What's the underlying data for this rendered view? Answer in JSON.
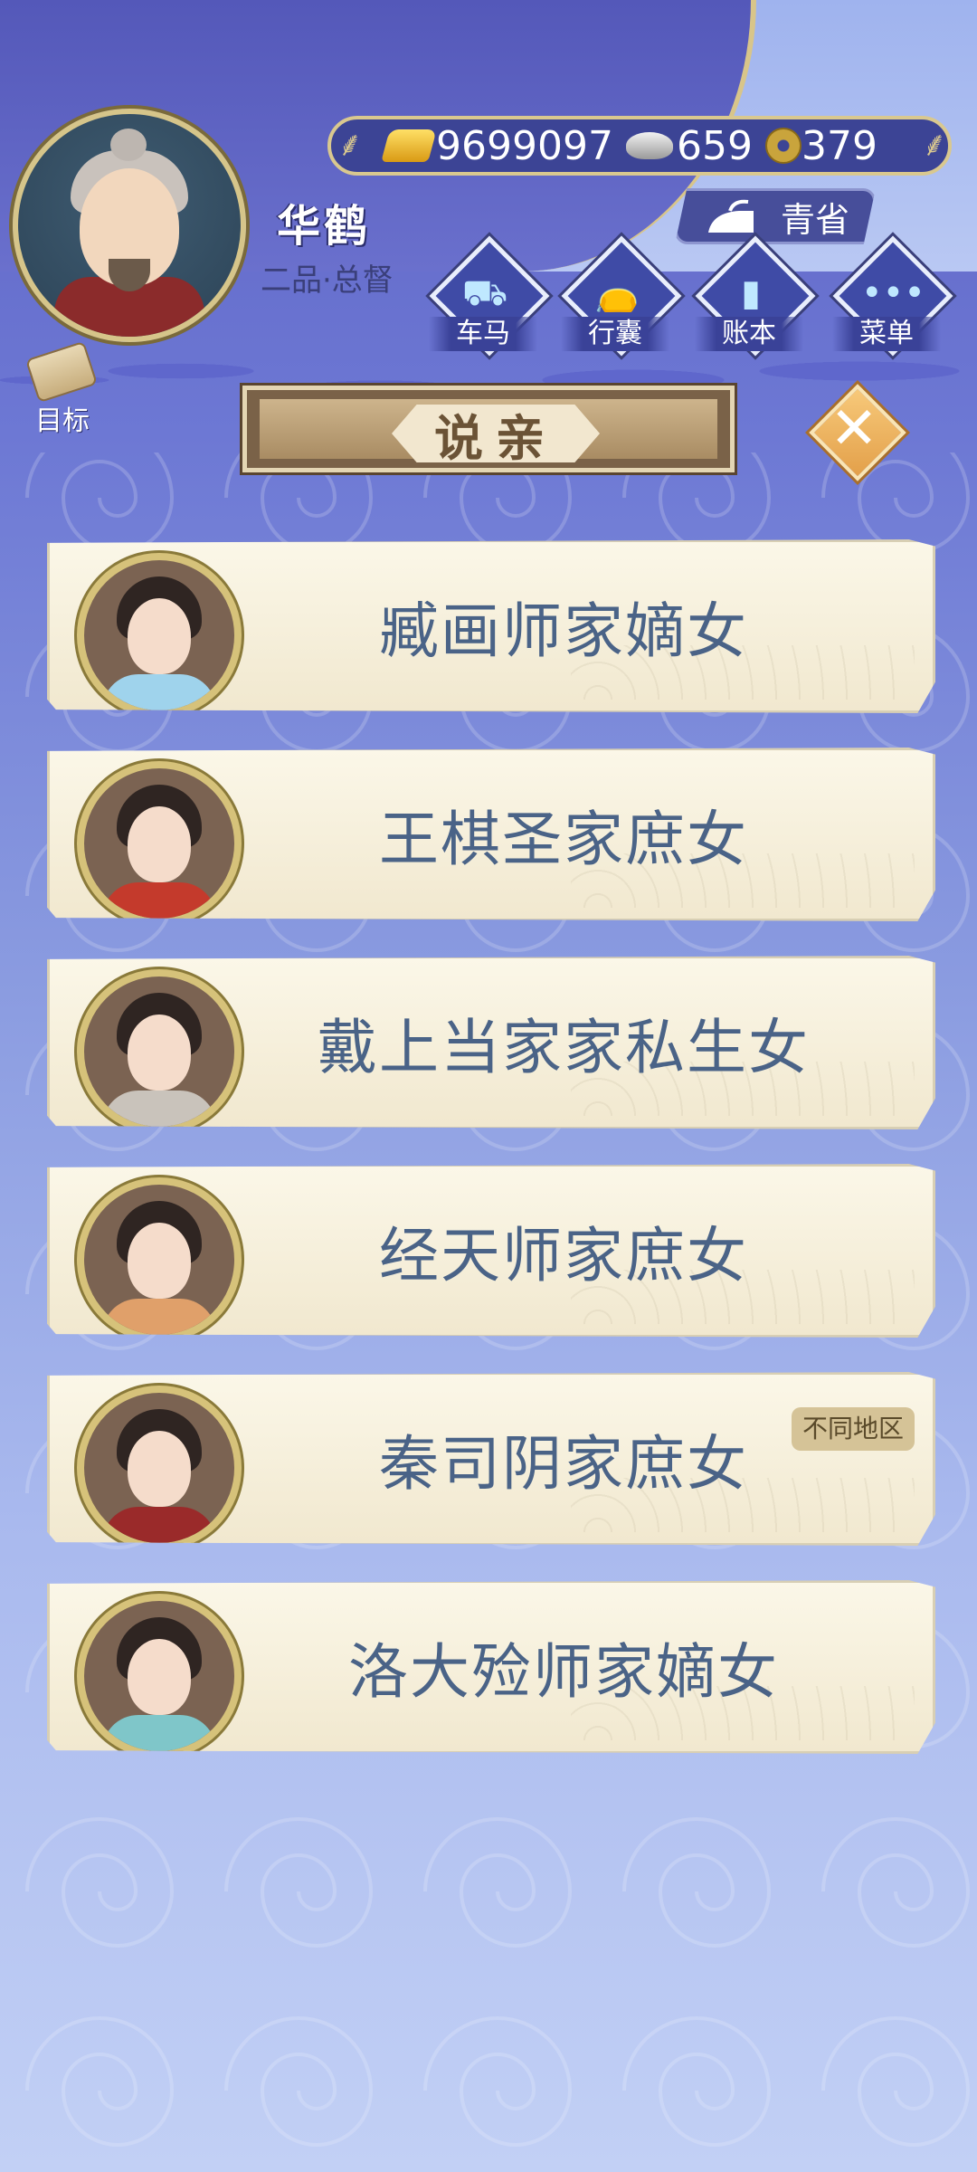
{
  "player": {
    "name": "华鹤",
    "rank": "二品·总督"
  },
  "currency": {
    "gold": "9699097",
    "silver": "659",
    "coins": "379"
  },
  "region": {
    "label": "青省"
  },
  "menu": [
    {
      "label": "车马",
      "icon": "carriage-icon"
    },
    {
      "label": "行囊",
      "icon": "bag-icon"
    },
    {
      "label": "账本",
      "icon": "ledger-icon"
    },
    {
      "label": "菜单",
      "icon": "more-icon"
    }
  ],
  "target": {
    "label": "目标"
  },
  "dialog": {
    "title": "说亲"
  },
  "candidates": [
    {
      "name": "臧画师家嫡女",
      "badge": ""
    },
    {
      "name": "王棋圣家庶女",
      "badge": ""
    },
    {
      "name": "戴上当家家私生女",
      "badge": ""
    },
    {
      "name": "经天师家庶女",
      "badge": ""
    },
    {
      "name": "秦司阴家庶女",
      "badge": "不同地区"
    },
    {
      "name": "洛大殓师家嫡女",
      "badge": ""
    }
  ],
  "colors": {
    "card_text": "#4a6387",
    "background_top": "#5e63c4",
    "background_bottom": "#c2d0f5",
    "accent_gold": "#d9c88f"
  }
}
